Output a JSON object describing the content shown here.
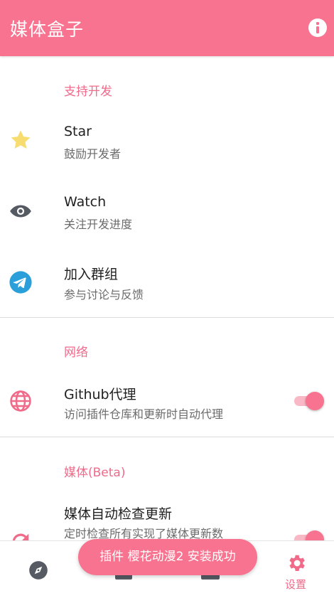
{
  "app": {
    "title": "媒体盒子"
  },
  "sections": {
    "support": {
      "title": "支持开发"
    },
    "network": {
      "title": "网络"
    },
    "media": {
      "title": "媒体(Beta)"
    }
  },
  "items": {
    "star": {
      "title": "Star",
      "subtitle": "鼓励开发者",
      "icon": "star-icon"
    },
    "watch": {
      "title": "Watch",
      "subtitle": "关注开发进度",
      "icon": "eye-icon"
    },
    "group": {
      "title": "加入群组",
      "subtitle": "参与讨论与反馈",
      "icon": "telegram-icon"
    },
    "proxy": {
      "title": "Github代理",
      "subtitle": "访问插件仓库和更新时自动代理",
      "icon": "globe-icon",
      "enabled": true
    },
    "autoupdate": {
      "title": "媒体自动检查更新",
      "subtitle": "定时检查所有实现了媒体更新数",
      "icon": "refresh-icon",
      "enabled": true
    }
  },
  "bottom_nav": {
    "settings_label": "设置"
  },
  "toast": {
    "text": "插件 樱花动漫2 安装成功"
  },
  "colors": {
    "primary": "#f7738f",
    "section_title": "#f06a8a",
    "star": "#f7dc6f",
    "eye": "#555a63",
    "telegram": "#2a9fd9"
  }
}
